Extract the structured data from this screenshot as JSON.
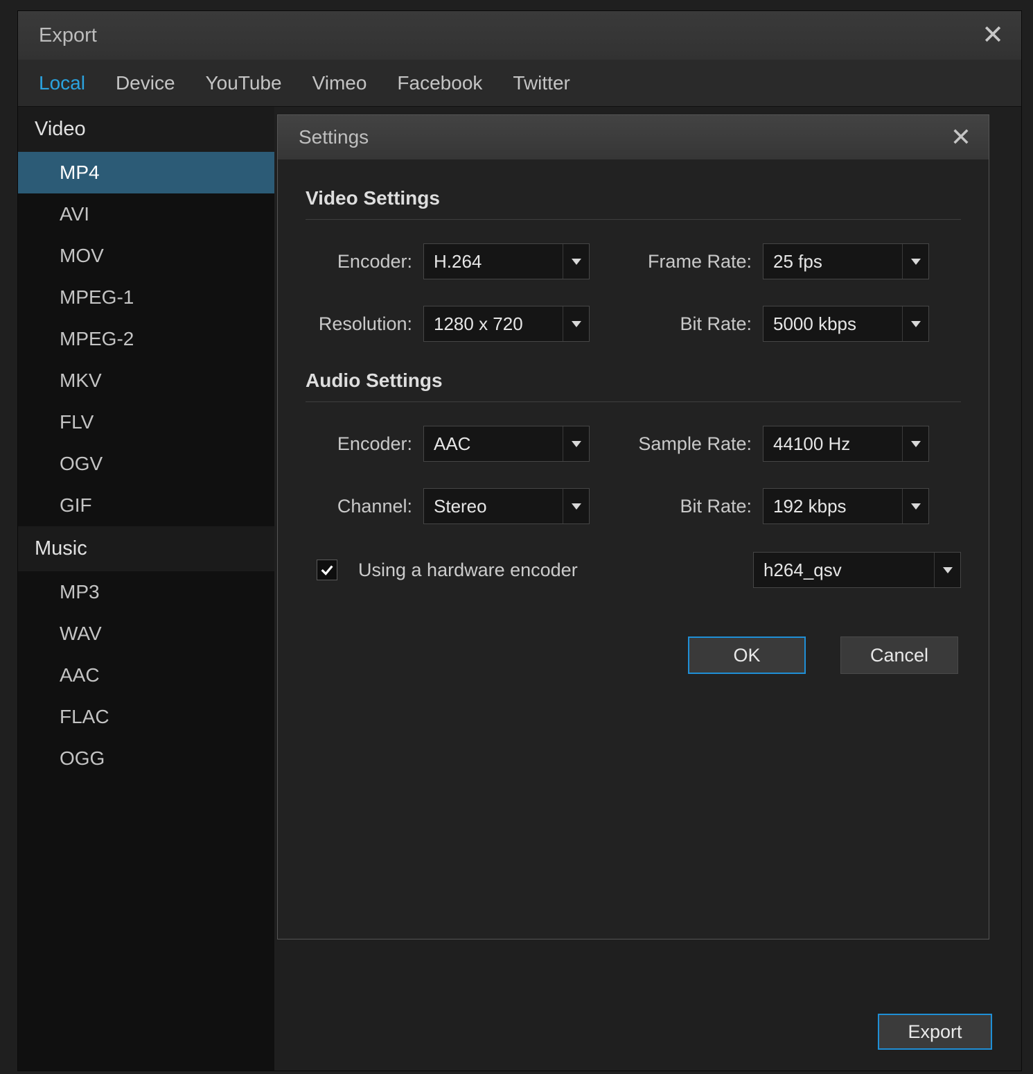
{
  "window": {
    "title": "Export"
  },
  "tabs": [
    {
      "label": "Local",
      "active": true
    },
    {
      "label": "Device",
      "active": false
    },
    {
      "label": "YouTube",
      "active": false
    },
    {
      "label": "Vimeo",
      "active": false
    },
    {
      "label": "Facebook",
      "active": false
    },
    {
      "label": "Twitter",
      "active": false
    }
  ],
  "sidebar": {
    "categories": [
      {
        "title": "Video",
        "items": [
          {
            "label": "MP4",
            "selected": true
          },
          {
            "label": "AVI",
            "selected": false
          },
          {
            "label": "MOV",
            "selected": false
          },
          {
            "label": "MPEG-1",
            "selected": false
          },
          {
            "label": "MPEG-2",
            "selected": false
          },
          {
            "label": "MKV",
            "selected": false
          },
          {
            "label": "FLV",
            "selected": false
          },
          {
            "label": "OGV",
            "selected": false
          },
          {
            "label": "GIF",
            "selected": false
          }
        ]
      },
      {
        "title": "Music",
        "items": [
          {
            "label": "MP3",
            "selected": false
          },
          {
            "label": "WAV",
            "selected": false
          },
          {
            "label": "AAC",
            "selected": false
          },
          {
            "label": "FLAC",
            "selected": false
          },
          {
            "label": "OGG",
            "selected": false
          }
        ]
      }
    ]
  },
  "settings": {
    "title": "Settings",
    "video_section": "Video Settings",
    "audio_section": "Audio Settings",
    "video": {
      "encoder_label": "Encoder:",
      "encoder_value": "H.264",
      "resolution_label": "Resolution:",
      "resolution_value": "1280 x 720",
      "framerate_label": "Frame Rate:",
      "framerate_value": "25 fps",
      "bitrate_label": "Bit Rate:",
      "bitrate_value": "5000 kbps"
    },
    "audio": {
      "encoder_label": "Encoder:",
      "encoder_value": "AAC",
      "channel_label": "Channel:",
      "channel_value": "Stereo",
      "samplerate_label": "Sample Rate:",
      "samplerate_value": "44100 Hz",
      "bitrate_label": "Bit Rate:",
      "bitrate_value": "192 kbps"
    },
    "hw_encoder": {
      "checked": true,
      "label": "Using a hardware encoder",
      "value": "h264_qsv"
    },
    "ok_label": "OK",
    "cancel_label": "Cancel"
  },
  "export_button": "Export"
}
